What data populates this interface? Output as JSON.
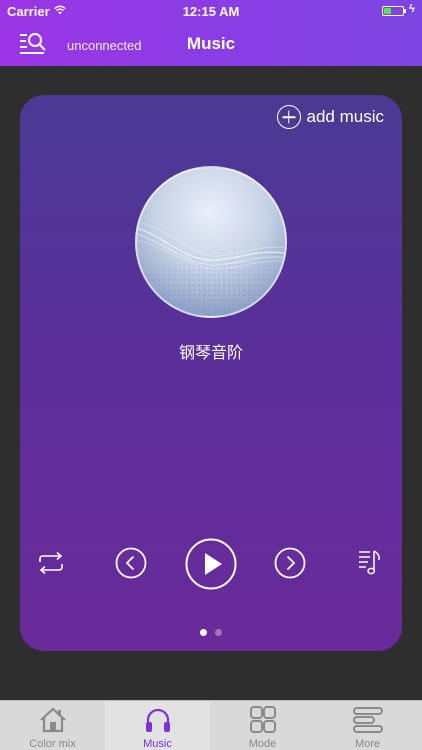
{
  "status_bar": {
    "carrier": "Carrier",
    "time": "12:15 AM"
  },
  "nav": {
    "connection": "unconnected",
    "title": "Music"
  },
  "card": {
    "add_music_label": "add music",
    "track_title": "钢琴音阶",
    "page_indicator": {
      "current": 1,
      "total": 2
    }
  },
  "tabs": [
    {
      "label": "Color mix",
      "icon": "home-icon",
      "active": false
    },
    {
      "label": "Music",
      "icon": "headphones-icon",
      "active": true
    },
    {
      "label": "Mode",
      "icon": "grid-icon",
      "active": false
    },
    {
      "label": "More",
      "icon": "menu-icon",
      "active": false
    }
  ],
  "colors": {
    "header_gradient_start": "#9b35e6",
    "header_gradient_end": "#7d45e2",
    "card_top": "#4a3a94",
    "card_bottom": "#6a2a9a",
    "tab_active": "#7a35d6",
    "tab_inactive": "#8a8a8a"
  }
}
